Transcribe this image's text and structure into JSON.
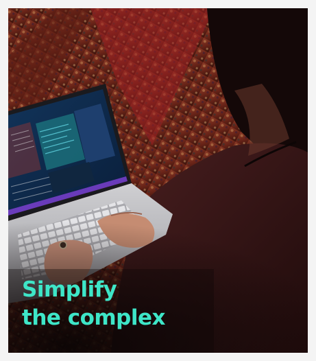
{
  "headline": {
    "line1": "Simplify",
    "line2": "the complex",
    "color": "#3ee6c8"
  },
  "colors": {
    "frame": "#f4f4f4",
    "photo_shadow": "#1b0e0a",
    "rug": "#7a2a1c",
    "sweater": "#3e1a1a",
    "screen_code": "#0f2a4a"
  }
}
